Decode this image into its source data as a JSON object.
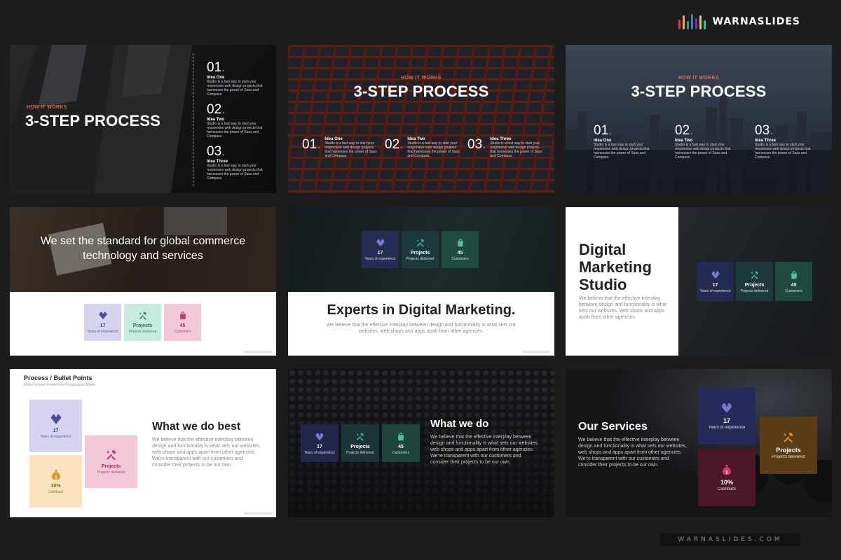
{
  "brand": {
    "name": "WARNASLIDES",
    "url": "WARNASLIDES.COM",
    "bar_colors": [
      "#e63946",
      "#f4a261",
      "#2a9d8f",
      "#457b9d",
      "#7b2cbf",
      "#e9c46a",
      "#06d6a0"
    ]
  },
  "colors": {
    "accent_pink": "#e0507a",
    "accent_orange": "#e06a4a"
  },
  "slides": {
    "s1": {
      "kicker": "HOW IT WORKS",
      "title": "3-STEP PROCESS",
      "steps": [
        {
          "num": "01",
          "dot": ".",
          "idea": "Idea One",
          "text": "Studio is a fast way to start your responsive web design projects that harnesses the power of Sass and Compass."
        },
        {
          "num": "02",
          "dot": ".",
          "idea": "Idea Two",
          "text": "Studio is a fast way to start your responsive web design projects that harnesses the power of Sass and Compass."
        },
        {
          "num": "03",
          "dot": ".",
          "idea": "Idea Three",
          "text": "Studio is a fast way to start your responsive web design projects that harnesses the power of Sass and Compass."
        }
      ]
    },
    "s2": {
      "kicker": "HOW IT WORKS",
      "title": "3-STEP PROCESS",
      "steps": [
        {
          "num": "01",
          "dot": ".",
          "idea": "Idea One",
          "text": "Studio is a fast way to start your responsive web design projects that harnesses the power of Sass and Compass."
        },
        {
          "num": "02",
          "dot": ".",
          "idea": "Idea Two",
          "text": "Studio is a fast way to start your responsive web design projects that harnesses the power of Sass and Compass."
        },
        {
          "num": "03",
          "dot": ".",
          "idea": "Idea Three",
          "text": "Studio is a fast way to start your responsive web design projects that harnesses the power of Sass and Compass."
        }
      ]
    },
    "s3": {
      "kicker": "HOW IT WORKS",
      "title": "3-STEP PROCESS",
      "steps": [
        {
          "num": "01",
          "dot": ".",
          "idea": "Idea One",
          "text": "Studio is a fast way to start your responsive web design projects that harnesses the power of Sass and Compass."
        },
        {
          "num": "02",
          "dot": ".",
          "idea": "Idea Two",
          "text": "Studio is a fast way to start your responsive web design projects that harnesses the power of Sass and Compass."
        },
        {
          "num": "03",
          "dot": ".",
          "idea": "Idea Three",
          "text": "Studio is a fast way to start your responsive web design projects that harnesses the power of Sass and Compass."
        }
      ]
    },
    "s4": {
      "headline": "We set the standard for global commerce technology and services",
      "stats": [
        {
          "value": "17",
          "label": "Years of experience",
          "icon": "diamond-icon"
        },
        {
          "value": "Projects",
          "label": "Projects delivered",
          "icon": "tools-icon"
        },
        {
          "value": "45",
          "label": "Customers",
          "icon": "bag-icon"
        }
      ]
    },
    "s5": {
      "headline": "Experts in Digital Marketing.",
      "body": "We believe that the effective interplay between design and functionality is what sets our websites, web shops and apps apart from other agencies.",
      "stats": [
        {
          "value": "17",
          "label": "Years of experience",
          "icon": "diamond-icon"
        },
        {
          "value": "Projects",
          "label": "Projects delivered",
          "icon": "tools-icon"
        },
        {
          "value": "45",
          "label": "Customers",
          "icon": "bag-icon"
        }
      ]
    },
    "s6": {
      "headline": "Digital Marketing Studio",
      "body": "We believe that the effective interplay between design and functionality is what sets our websites, web shops and apps apart from other agencies.",
      "stats": [
        {
          "value": "17",
          "label": "Years of experience",
          "icon": "diamond-icon"
        },
        {
          "value": "Projects",
          "label": "Projects delivered",
          "icon": "tools-icon"
        },
        {
          "value": "45",
          "label": "Customers",
          "icon": "bag-icon"
        }
      ]
    },
    "s7": {
      "title": "Process / Bullet Points",
      "subtitle": "Multi-Purpose PowerPoint Presentation Maker",
      "headline": "What we do best",
      "body": "We believe that the effective interplay between design and functionality is what sets our websites, web shops and apps apart from other agencies. We're transparent with our customers and consider their projects to be our own.",
      "stats": [
        {
          "value": "17",
          "label": "Years of experience",
          "icon": "diamond-icon"
        },
        {
          "value": "Projects",
          "label": "Projects delivered",
          "icon": "tools-icon"
        },
        {
          "value": "10%",
          "label": "Cashback",
          "icon": "money-bag-icon"
        }
      ]
    },
    "s8": {
      "headline": "What we do",
      "body": "We believe that the effective interplay between design and functionality is what sets our websites, web shops and apps apart from other agencies. We're transparent with our customers and consider their projects to be our own.",
      "stats": [
        {
          "value": "17",
          "label": "Years of experience",
          "icon": "diamond-icon"
        },
        {
          "value": "Projects",
          "label": "Projects delivered",
          "icon": "tools-icon"
        },
        {
          "value": "45",
          "label": "Customers",
          "icon": "bag-icon"
        }
      ]
    },
    "s9": {
      "headline": "Our Services",
      "body": "We believe that the effective interplay between design and functionality is what sets our websites, web shops and apps apart from other agencies. We're transparent with our customers and consider their projects to be our own.",
      "stats": [
        {
          "value": "17",
          "label": "Years of experience",
          "icon": "diamond-icon"
        },
        {
          "value": "Projects",
          "label": "Projects delivered",
          "icon": "tools-icon"
        },
        {
          "value": "10%",
          "label": "Cashback",
          "icon": "money-bag-icon"
        }
      ]
    }
  }
}
